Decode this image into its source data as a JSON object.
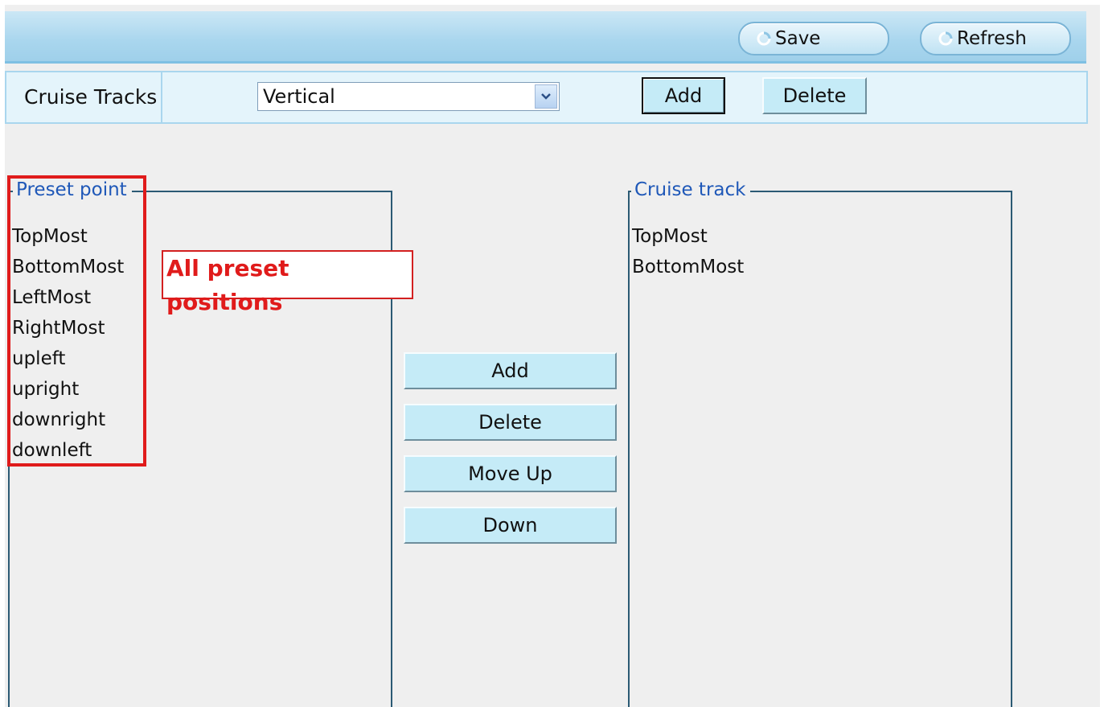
{
  "toolbar": {
    "save_label": "Save",
    "refresh_label": "Refresh"
  },
  "tracks": {
    "label": "Cruise Tracks",
    "selected": "Vertical",
    "add_label": "Add",
    "delete_label": "Delete"
  },
  "preset": {
    "legend": "Preset point",
    "items": [
      "TopMost",
      "BottomMost",
      "LeftMost",
      "RightMost",
      "upleft",
      "upright",
      "downright",
      "downleft"
    ]
  },
  "annotation": {
    "text": "All preset positions",
    "color": "#e01b1b"
  },
  "actions": {
    "add_label": "Add",
    "delete_label": "Delete",
    "move_up_label": "Move Up",
    "down_label": "Down"
  },
  "cruise": {
    "legend": "Cruise track",
    "items": [
      "TopMost",
      "BottomMost"
    ]
  },
  "colors": {
    "toolbar": "#a9d6ee",
    "button": "#c5ebf7",
    "legend": "#1f58b8",
    "fieldset_border": "#2b5a74"
  },
  "icons": {
    "save": "refresh-arrow-icon",
    "refresh": "refresh-arrow-icon",
    "dropdown": "chevron-down-icon"
  }
}
